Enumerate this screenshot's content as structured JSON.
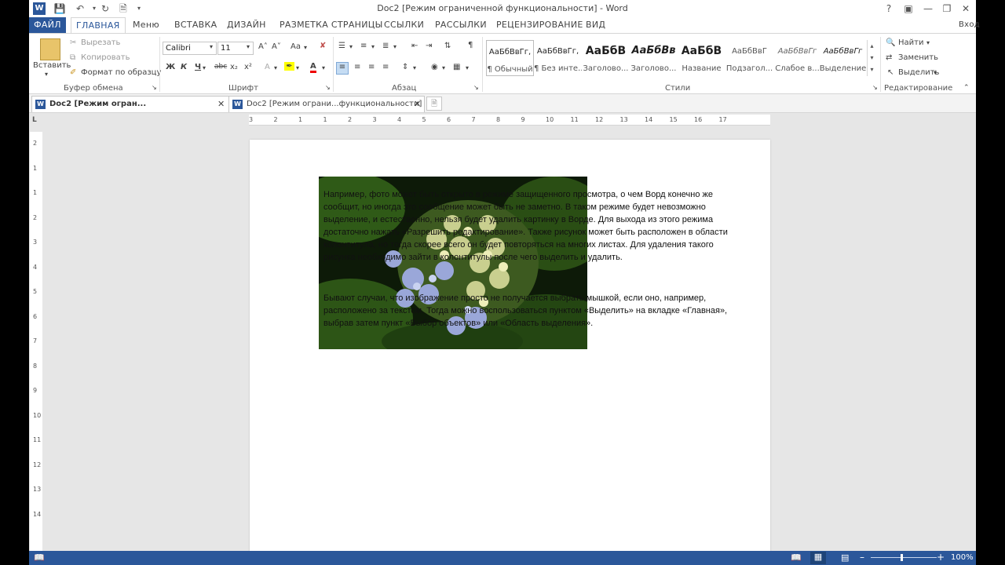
{
  "window": {
    "title": "Doc2 [Режим ограниченной функциональности] - Word",
    "help": "?",
    "sign_in": "Вход"
  },
  "ribbon_tabs": [
    "ФАЙЛ",
    "ГЛАВНАЯ",
    "Меню",
    "ВСТАВКА",
    "ДИЗАЙН",
    "РАЗМЕТКА СТРАНИЦЫ",
    "ССЫЛКИ",
    "РАССЫЛКИ",
    "РЕЦЕНЗИРОВАНИЕ",
    "ВИД"
  ],
  "clipboard": {
    "paste": "Вставить",
    "cut": "Вырезать",
    "copy": "Копировать",
    "format_painter": "Формат по образцу",
    "label": "Буфер обмена"
  },
  "font": {
    "name": "Calibri",
    "size": "11",
    "label": "Шрифт",
    "bold": "Ж",
    "italic": "К",
    "underline": "Ч",
    "strike": "abc",
    "sub": "x₂",
    "sup": "x²",
    "case": "Aa"
  },
  "paragraph": {
    "label": "Абзац"
  },
  "styles": {
    "label": "Стили",
    "items": [
      {
        "preview": "АаБбВвГг,",
        "name": "¶ Обычный"
      },
      {
        "preview": "АаБбВвГг,",
        "name": "¶ Без инте..."
      },
      {
        "preview": "АаБбВ",
        "name": "Заголово..."
      },
      {
        "preview": "АаБбВв",
        "name": "Заголово..."
      },
      {
        "preview": "АаБбВ",
        "name": "Название"
      },
      {
        "preview": "АаБбВвГ",
        "name": "Подзагол..."
      },
      {
        "preview": "АаБбВвГг",
        "name": "Слабое в..."
      },
      {
        "preview": "АаБбВвГг",
        "name": "Выделение"
      }
    ]
  },
  "editing": {
    "find": "Найти",
    "replace": "Заменить",
    "select": "Выделить",
    "label": "Редактирование"
  },
  "doc_tabs": [
    {
      "label": "Doc2 [Режим огран... функциональности]"
    },
    {
      "label": "Doc2 [Режим ограни...функциональности] *"
    }
  ],
  "ruler": {
    "h": [
      "3",
      "2",
      "1",
      "1",
      "2",
      "3",
      "4",
      "5",
      "6",
      "7",
      "8",
      "9",
      "10",
      "11",
      "12",
      "13",
      "14",
      "15",
      "16",
      "17"
    ],
    "v": [
      "2",
      "1",
      "1",
      "2",
      "3",
      "4",
      "5",
      "6",
      "7",
      "8",
      "9",
      "10",
      "11",
      "12",
      "13",
      "14"
    ]
  },
  "document": {
    "para1": "Например, фото может быть открыто в режиме защищенного просмотра, о чем Ворд конечно же сообщит, но иногда это сообщение может быть не заметно. В таком режиме будет невозможно выделение, и естественно, нельзя будет удалить картинку в Ворде. Для выхода из этого режима достаточно нажать «Разрешить редактирование». Также рисунок может быть расположен в области колонтитула, но тогда скорее всего он будет повторяться на многих листах. Для удаления такого рисунка необходимо зайти в колонтитулы после чего выделить и удалить.",
    "para2": "Бывают случаи, что изображение просто не получается выбрать мышкой, если оно, например, расположено за текстом. Тогда можно воспользоваться пунктом «Выделить» на вкладке «Главная», выбрав затем пункт «Выбор объектов» или «Область выделения»."
  },
  "status": {
    "zoom": "100%"
  },
  "colors": {
    "accent": "#2b579a"
  }
}
